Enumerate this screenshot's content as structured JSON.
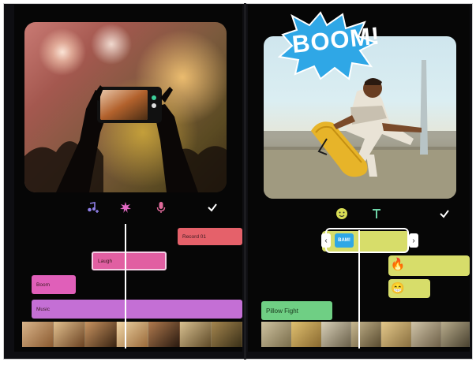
{
  "left_panel": {
    "toolbar_icons": [
      {
        "icon": "music-note-add-icon",
        "color": "#8f7fe8"
      },
      {
        "icon": "sound-effect-icon",
        "color": "#e36ac5"
      },
      {
        "icon": "microphone-icon",
        "color": "#e06a9a"
      },
      {
        "icon": "checkmark-icon",
        "color": "#ffffff"
      }
    ],
    "clips": {
      "record": "Record 01",
      "laugh": "Laugh",
      "boom": "Boom",
      "music": "Music"
    },
    "colors": {
      "record": "#e5616a",
      "laugh": "#e15fa2",
      "boom": "#e05fb9",
      "music": "#c46fd5"
    }
  },
  "right_panel": {
    "sticker_text": "BOOM!",
    "toolbar_icons": [
      {
        "icon": "emoji-sticker-icon",
        "color": "#d8dd55"
      },
      {
        "icon": "text-icon",
        "color": "#6ed4a8"
      },
      {
        "icon": "checkmark-icon",
        "color": "#ffffff"
      }
    ],
    "clips": {
      "boom_sticker": "BAM!",
      "fire_emoji": "🔥",
      "grin_emoji": "😁",
      "pillow_fight": "Pillow Fight"
    },
    "colors": {
      "sticker_track": "#d7dd6a",
      "text_track": "#6fcf84"
    }
  }
}
